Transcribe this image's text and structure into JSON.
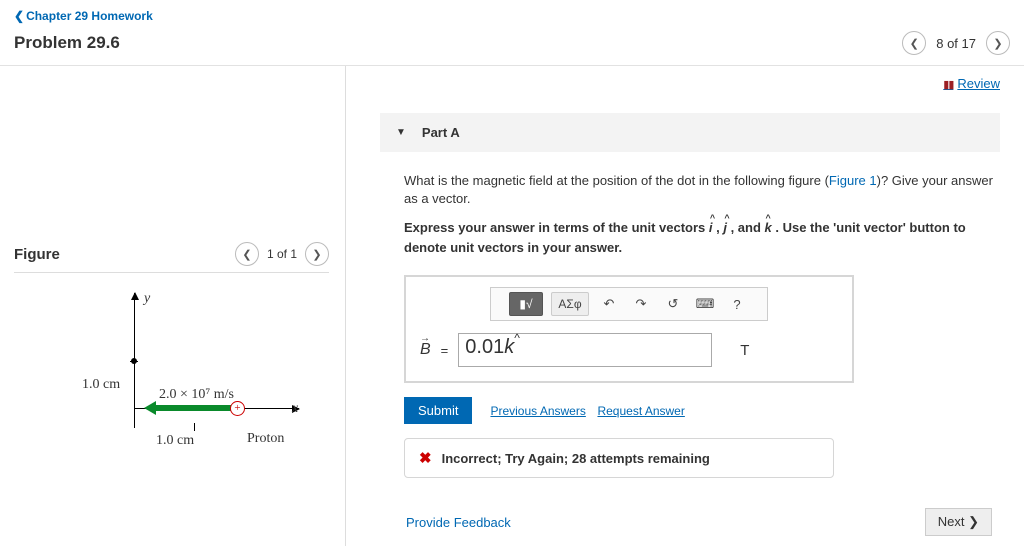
{
  "nav": {
    "chapter_link": "Chapter 29 Homework",
    "problem_title": "Problem 29.6",
    "pager_text": "8 of 17"
  },
  "review_label": "Review",
  "part": {
    "label": "Part A",
    "question_prefix": "What is the magnetic field at the position of the dot in the following figure (",
    "figure_link_text": "Figure 1",
    "question_suffix": ")? Give your answer as a vector.",
    "hint": "Express your answer in terms of the unit vectors î, ĵ, and k̂. Use the 'unit vector' button to denote unit vectors in your answer."
  },
  "toolbar": {
    "templates": "√",
    "symbols": "ΑΣφ",
    "undo": "↶",
    "redo": "↷",
    "reset": "↺",
    "keyboard": "⌨",
    "help": "?"
  },
  "answer": {
    "lhs": "B",
    "equals": "=",
    "value": "0.01k̂",
    "unit": "T"
  },
  "buttons": {
    "submit": "Submit",
    "previous": "Previous Answers",
    "request": "Request Answer",
    "feedback": "Provide Feedback",
    "next": "Next"
  },
  "feedback_msg": "Incorrect; Try Again; 28 attempts remaining",
  "figure": {
    "heading": "Figure",
    "pager": "1 of 1",
    "y_label": "y",
    "x_label": "x",
    "dist1": "1.0 cm",
    "dist2": "1.0 cm",
    "velocity": "2.0 × 10⁷ m/s",
    "particle": "Proton"
  },
  "chart_data": {
    "type": "diagram",
    "description": "Proton on x-axis moving in -x direction; observation dot on y-axis above origin",
    "proton_position_cm": {
      "x": 1.0,
      "y": 0.0
    },
    "dot_position_cm": {
      "x": 0.0,
      "y": 1.0
    },
    "velocity_m_per_s": 20000000.0,
    "velocity_direction": "-x",
    "axes": [
      "x",
      "y"
    ]
  }
}
